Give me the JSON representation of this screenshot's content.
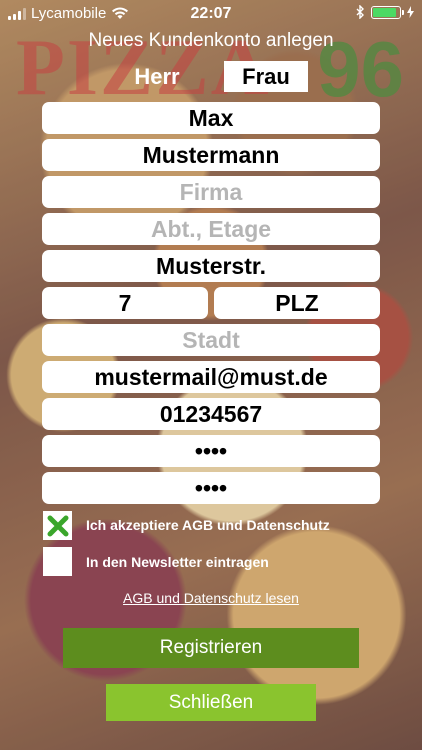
{
  "status_bar": {
    "carrier": "Lycamobile",
    "time": "22:07",
    "battery_level": 0.9
  },
  "background_logo": {
    "word": "PIZZA",
    "number": "96"
  },
  "title": "Neues Kundenkonto anlegen",
  "gender": {
    "options": [
      "Herr",
      "Frau"
    ],
    "selected": "Frau"
  },
  "form": {
    "first_name": "Max",
    "last_name": "Mustermann",
    "company_placeholder": "Firma",
    "department_placeholder": "Abt., Etage",
    "street": "Musterstr.",
    "house_number": "7",
    "zip_placeholder": "PLZ",
    "city_placeholder": "Stadt",
    "email": "mustermail@must.de",
    "phone": "01234567",
    "password": "••••",
    "password_repeat": "••••"
  },
  "checkboxes": {
    "terms": {
      "label": "Ich akzeptiere AGB und Datenschutz",
      "checked": true
    },
    "newsletter": {
      "label": "In den Newsletter eintragen",
      "checked": false
    }
  },
  "terms_link": "AGB und Datenschutz lesen",
  "buttons": {
    "register": "Registrieren",
    "close": "Schließen"
  },
  "colors": {
    "register_bg": "#5d8d1e",
    "close_bg": "#8ac42e",
    "check_mark": "#3aa62b"
  }
}
